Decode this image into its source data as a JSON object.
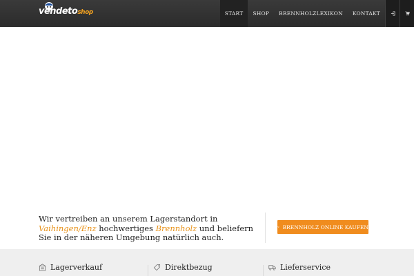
{
  "header": {
    "logo": {
      "text_main": "vendeto",
      "text_accent": "shop"
    },
    "nav": [
      {
        "label": "START"
      },
      {
        "label": "SHOP"
      },
      {
        "label": "BRENNHOLZLEXIKON"
      },
      {
        "label": "KONTAKT"
      }
    ],
    "icons": [
      "login-icon",
      "cart-icon"
    ]
  },
  "intro": {
    "part1": "Wir vertreiben an unserem Lagerstandort in ",
    "highlight1": "Vaihingen/Enz",
    "part2": " hochwertiges ",
    "highlight2": "Brennholz",
    "part3": " und beliefern Sie in der näheren Umgebung natürlich auch.",
    "highlight_color": "#e8921a"
  },
  "cta": {
    "label": "BRENNHOLZ ONLINE KAUFEN",
    "icon": "cart-icon",
    "color": "#f08c1e"
  },
  "features": [
    {
      "label": "Lagerverkauf",
      "icon": "storage-icon"
    },
    {
      "label": "Direktbezug",
      "icon": "tag-icon"
    },
    {
      "label": "Lieferservice",
      "icon": "truck-icon"
    }
  ]
}
